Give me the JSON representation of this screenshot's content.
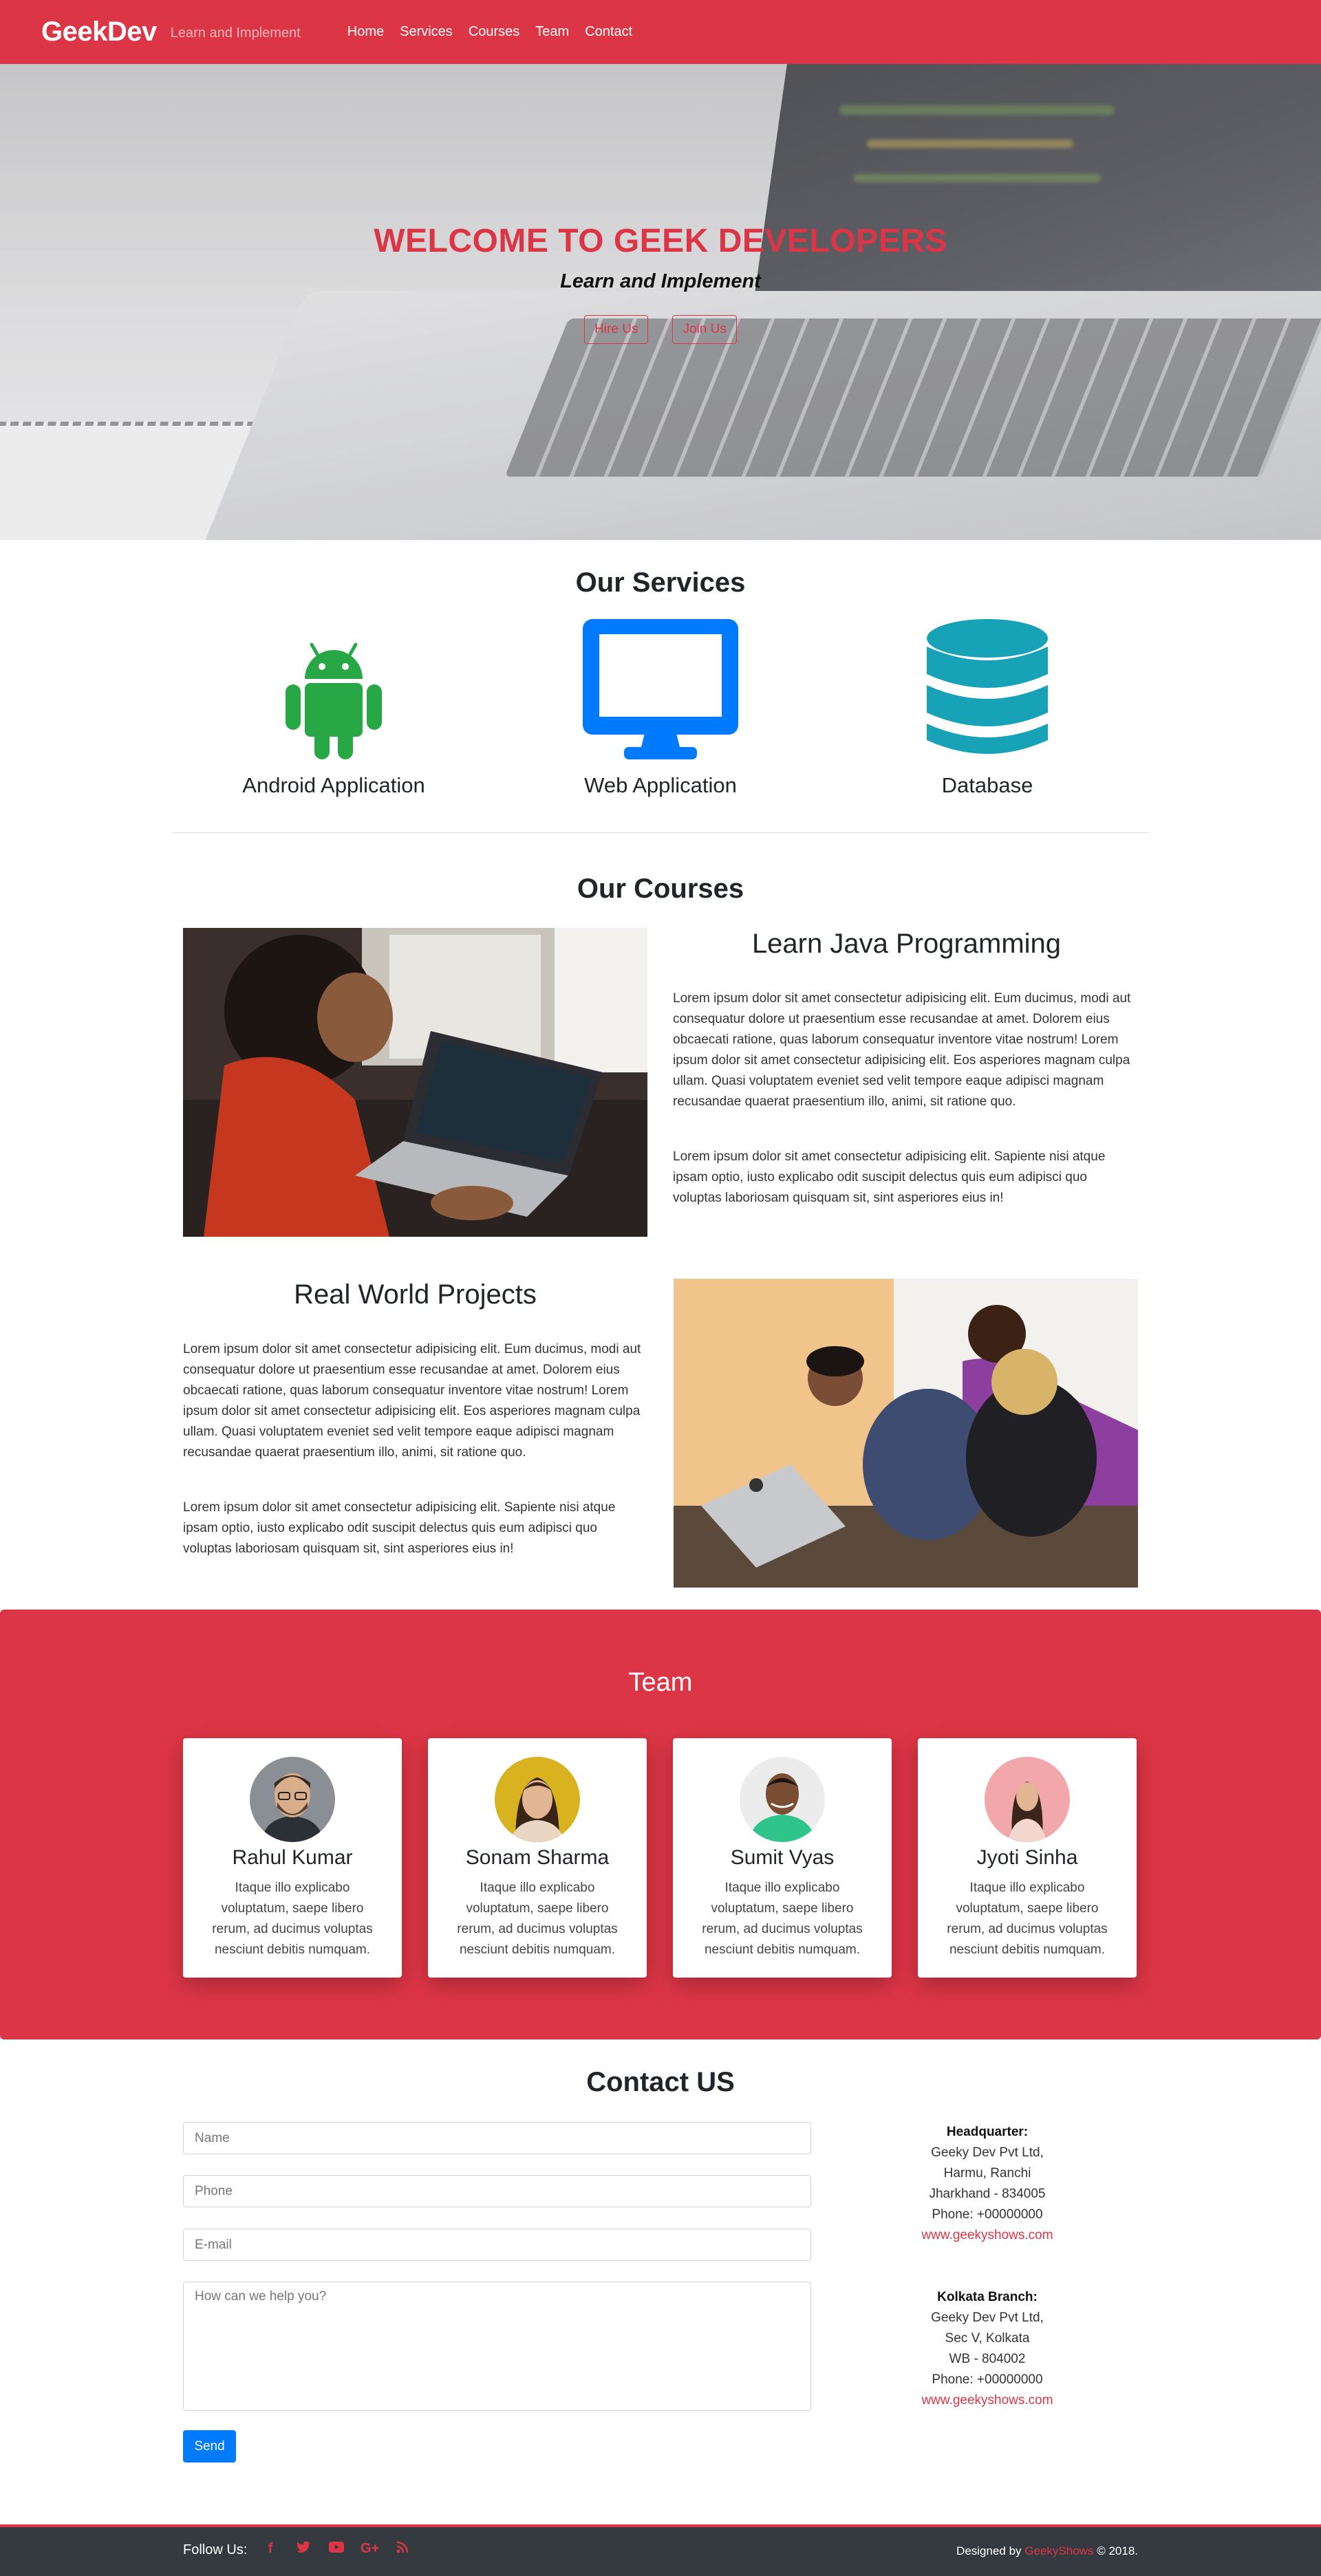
{
  "navbar": {
    "brand": "GeekDev",
    "tagline": "Learn and Implement",
    "links": [
      "Home",
      "Services",
      "Courses",
      "Team",
      "Contact"
    ]
  },
  "hero": {
    "title": "WELCOME TO GEEK DEVELOPERS",
    "subtitle": "Learn and Implement",
    "buttons": [
      "Hire Us",
      "Join Us"
    ]
  },
  "services": {
    "title": "Our Services",
    "items": [
      {
        "label": "Android Application",
        "icon": "android-icon",
        "color": "#28a745"
      },
      {
        "label": "Web Application",
        "icon": "desktop-icon",
        "color": "#007bff"
      },
      {
        "label": "Database",
        "icon": "database-icon",
        "color": "#17a2b8"
      }
    ]
  },
  "courses": {
    "title": "Our Courses",
    "java": {
      "title": "Learn Java Programming",
      "p1": "Lorem ipsum dolor sit amet consectetur adipisicing elit. Eum ducimus, modi aut consequatur dolore ut praesentium esse recusandae at amet. Dolorem eius obcaecati ratione, quas laborum consequatur inventore vitae nostrum! Lorem ipsum dolor sit amet consectetur adipisicing elit. Eos asperiores magnam culpa ullam. Quasi voluptatem eveniet sed velit tempore eaque adipisci magnam recusandae quaerat praesentium illo, animi, sit ratione quo.",
      "p2": "Lorem ipsum dolor sit amet consectetur adipisicing elit. Sapiente nisi atque ipsam optio, iusto explicabo odit suscipit delectus quis eum adipisci quo voluptas laboriosam quisquam sit, sint asperiores eius in!"
    },
    "projects": {
      "title": "Real World Projects",
      "p1": "Lorem ipsum dolor sit amet consectetur adipisicing elit. Eum ducimus, modi aut consequatur dolore ut praesentium esse recusandae at amet. Dolorem eius obcaecati ratione, quas laborum consequatur inventore vitae nostrum! Lorem ipsum dolor sit amet consectetur adipisicing elit. Eos asperiores magnam culpa ullam. Quasi voluptatem eveniet sed velit tempore eaque adipisci magnam recusandae quaerat praesentium illo, animi, sit ratione quo.",
      "p2": "Lorem ipsum dolor sit amet consectetur adipisicing elit. Sapiente nisi atque ipsam optio, iusto explicabo odit suscipit delectus quis eum adipisci quo voluptas laboriosam quisquam sit, sint asperiores eius in!"
    }
  },
  "team": {
    "title": "Team",
    "members": [
      {
        "name": "Rahul Kumar",
        "bio": "Itaque illo explicabo voluptatum, saepe libero rerum, ad ducimus voluptas nesciunt debitis numquam.",
        "avatar_bg": "#8a8f96"
      },
      {
        "name": "Sonam Sharma",
        "bio": "Itaque illo explicabo voluptatum, saepe libero rerum, ad ducimus voluptas nesciunt debitis numquam.",
        "avatar_bg": "#d9b21f"
      },
      {
        "name": "Sumit Vyas",
        "bio": "Itaque illo explicabo voluptatum, saepe libero rerum, ad ducimus voluptas nesciunt debitis numquam.",
        "avatar_bg": "#e9e9e9"
      },
      {
        "name": "Jyoti Sinha",
        "bio": "Itaque illo explicabo voluptatum, saepe libero rerum, ad ducimus voluptas nesciunt debitis numquam.",
        "avatar_bg": "#f2a7ab"
      }
    ]
  },
  "contact": {
    "title": "Contact US",
    "placeholders": {
      "name": "Name",
      "phone": "Phone",
      "email": "E-mail",
      "message": "How can we help you?"
    },
    "send_label": "Send",
    "hq": {
      "heading": "Headquarter:",
      "company": "Geeky Dev Pvt Ltd,",
      "line1": "Harmu, Ranchi",
      "line2": "Jharkhand - 834005",
      "phone": "Phone: +00000000",
      "link": "www.geekyshows.com"
    },
    "branch": {
      "heading": "Kolkata Branch:",
      "company": "Geeky Dev Pvt Ltd,",
      "line1": "Sec V, Kolkata",
      "line2": "WB - 804002",
      "phone": "Phone: +00000000",
      "link": "www.geekyshows.com"
    }
  },
  "footer": {
    "follow_label": "Follow Us:",
    "socials": [
      {
        "icon": "facebook-icon",
        "glyph": "f"
      },
      {
        "icon": "twitter-icon",
        "glyph": "🐦"
      },
      {
        "icon": "youtube-icon",
        "glyph": "▶"
      },
      {
        "icon": "google-plus-icon",
        "glyph": "G+"
      },
      {
        "icon": "rss-icon",
        "glyph": "◉"
      }
    ],
    "credit_prefix": "Designed by",
    "credit_brand": "GeekyShows",
    "credit_suffix": "© 2018."
  },
  "colors": {
    "primary": "#dc3545",
    "android": "#28a745",
    "web": "#007bff",
    "database": "#17a2b8",
    "footer": "#343a40"
  }
}
